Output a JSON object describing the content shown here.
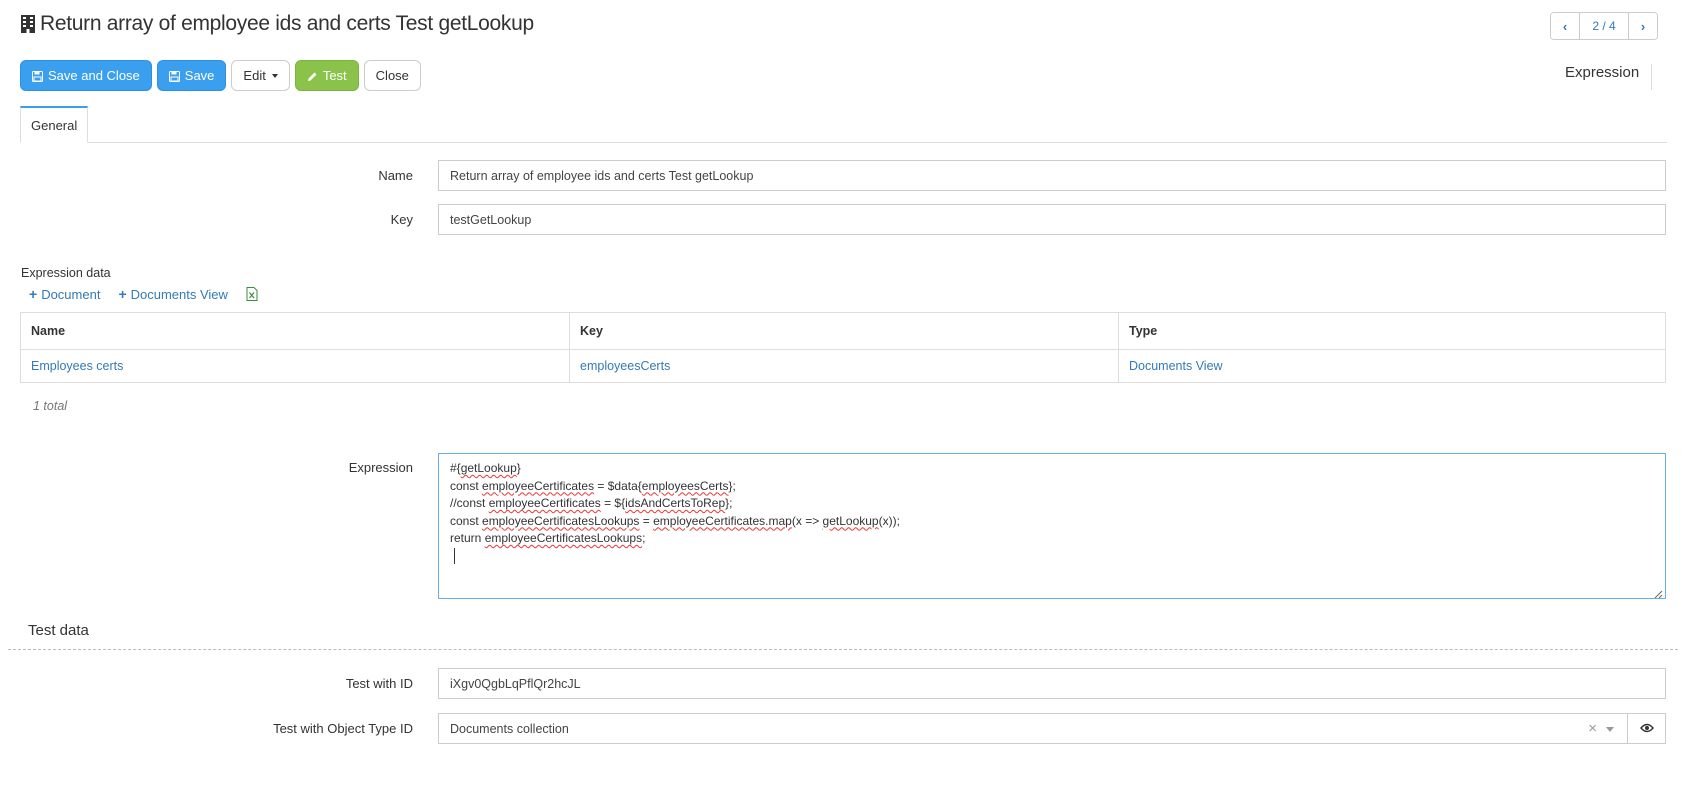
{
  "header": {
    "title": "Return array of employee ids and certs Test getLookup",
    "title_icon": "building-icon"
  },
  "pager": {
    "count": "2 / 4",
    "prev_icon": "chevron-left-icon",
    "next_icon": "chevron-right-icon"
  },
  "toolbar": {
    "save_close_label": "Save and Close",
    "save_label": "Save",
    "edit_label": "Edit",
    "test_label": "Test",
    "close_label": "Close"
  },
  "side_label": "Expression",
  "tabs": [
    {
      "label": "General",
      "active": true
    }
  ],
  "form": {
    "name_label": "Name",
    "name_value": "Return array of employee ids and certs Test getLookup",
    "key_label": "Key",
    "key_value": "testGetLookup",
    "expression_label": "Expression"
  },
  "expression_data": {
    "title": "Expression data",
    "add_document": "Document",
    "add_documents_view": "Documents View",
    "export_icon": "excel-file-icon",
    "columns": [
      "Name",
      "Key",
      "Type"
    ],
    "rows": [
      {
        "name": "Employees certs",
        "key": "employeesCerts",
        "type": "Documents View"
      }
    ],
    "total": "1 total"
  },
  "expression_code": {
    "line1": "#{getLookup}",
    "line2": "const employeeCertificates = $data{employeesCerts};",
    "line3": "//const employeeCertificates = ${idsAndCertsToRep};",
    "line4": "const employeeCertificatesLookups = employeeCertificates.map(x => getLookup(x));",
    "line5": "return employeeCertificatesLookups;"
  },
  "test_data": {
    "title": "Test data",
    "test_id_label": "Test with ID",
    "test_id_value": "iXgv0QgbLqPflQr2hcJL",
    "object_type_label": "Test with Object Type ID",
    "object_type_value": "Documents collection"
  },
  "colors": {
    "primary": "#3b9ff0",
    "success": "#8bc34a",
    "link": "#337ab7"
  }
}
